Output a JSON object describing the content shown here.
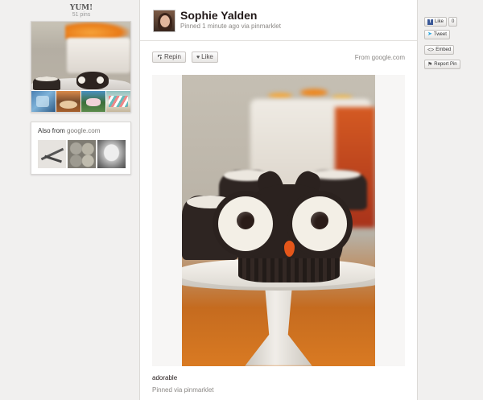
{
  "board": {
    "title": "YUM!",
    "count": "51 pins"
  },
  "also_from": {
    "prefix": "Also from",
    "source": "google.com"
  },
  "pin": {
    "pinner_name": "Sophie Yalden",
    "pinned_meta": "Pinned 1 minute ago via pinmarklet",
    "repin_label": "Repin",
    "like_label": "Like",
    "source_prefix": "From",
    "source_domain": "google.com",
    "description": "adorable",
    "via_text": "Pinned via pinmarklet"
  },
  "social": {
    "fb_like_label": "Like",
    "fb_like_count": "0",
    "tweet_label": "Tweet",
    "embed_label": "Embed",
    "report_label": "Report Pin"
  },
  "colors": {
    "page_background": "#f1f0ef",
    "card_background": "#ffffff",
    "facebook_blue": "#3b5998",
    "twitter_blue": "#2aa7e0"
  },
  "icons": {
    "repin": "repin-icon",
    "like": "heart-icon",
    "facebook": "facebook-icon",
    "twitter": "twitter-bird-icon",
    "embed": "code-icon",
    "report": "flag-icon"
  }
}
